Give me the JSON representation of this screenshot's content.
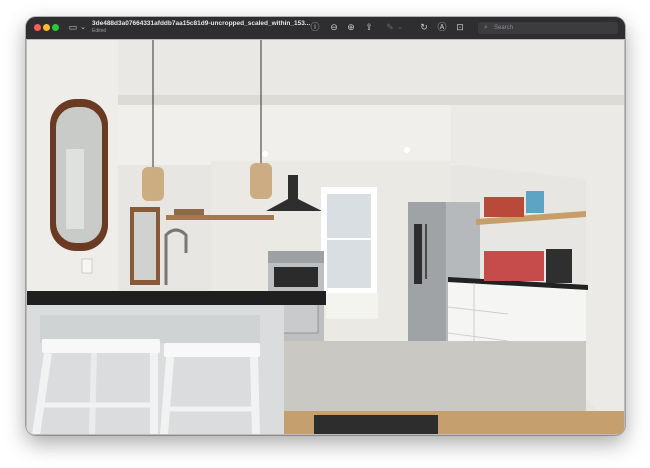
{
  "window": {
    "title": "3de488d3a07664331afddb7aa15c81d9-uncropped_scaled_within_153...",
    "subtitle": "Edited"
  },
  "toolbar": {
    "sidebar_icon": "sidebar-toggle-icon",
    "sidebar_glyph": "▭",
    "chevron_glyph": "⌄",
    "info_glyph": "ⓘ",
    "zoom_out_glyph": "⊖",
    "zoom_in_glyph": "⊕",
    "share_glyph": "⇪",
    "markup_glyph": "✎",
    "rotate_glyph": "↻",
    "highlight_glyph": "Ⓐ",
    "search_placeholder": "Search"
  },
  "photo": {
    "description_icon": "kitchen-photo",
    "colors": {
      "wall": "#ecebe7",
      "counter": "#2a2a2a",
      "cabinet": "#f4f4f2",
      "floor": "#c9c7c1",
      "wood": "#d6b98f"
    }
  }
}
